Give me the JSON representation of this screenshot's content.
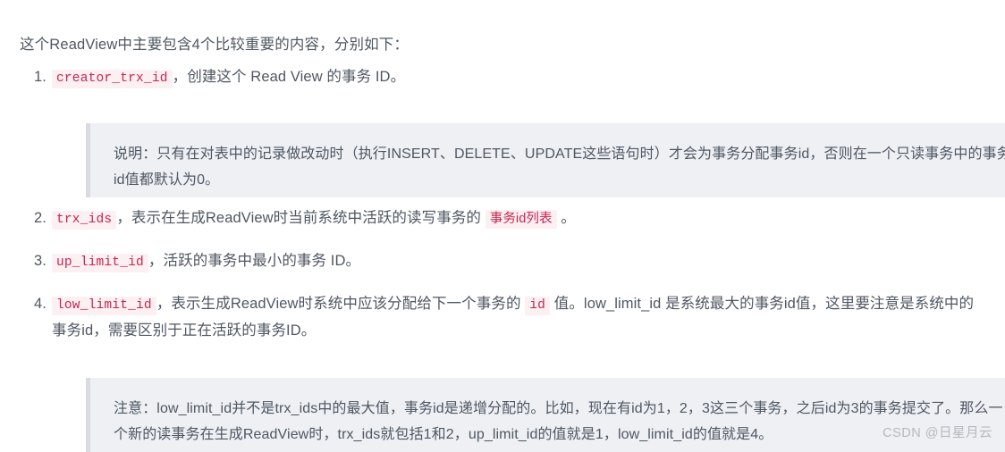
{
  "intro": "这个ReadView中主要包含4个比较重要的内容，分别如下：",
  "list": [
    {
      "marker": "1.",
      "code": "creator_trx_id",
      "text_after": "，创建这个 Read View 的事务 ID。"
    },
    {
      "marker": "2.",
      "code": "trx_ids",
      "text_mid": "，表示在生成ReadView时当前系统中活跃的读写事务的 ",
      "code2": "事务id列表",
      "text_after": " 。"
    },
    {
      "marker": "3.",
      "code": "up_limit_id",
      "text_after": "，活跃的事务中最小的事务 ID。"
    },
    {
      "marker": "4.",
      "code": "low_limit_id",
      "text_mid": "，表示生成ReadView时系统中应该分配给下一个事务的 ",
      "code2": "id",
      "text_after": " 值。low_limit_id 是系统最大的事务id值，这里要注意是系统中的事务id，需要区别于正在活跃的事务ID。"
    }
  ],
  "notes": [
    {
      "id": "note-1",
      "text": "说明：只有在对表中的记录做改动时（执行INSERT、DELETE、UPDATE这些语句时）才会为事务分配事务id，否则在一个只读事务中的事务id值都默认为0。"
    },
    {
      "id": "note-2",
      "text": "注意：low_limit_id并不是trx_ids中的最大值，事务id是递增分配的。比如，现在有id为1，2，3这三个事务，之后id为3的事务提交了。那么一个新的读事务在生成ReadView时，trx_ids就包括1和2，up_limit_id的值就是1，low_limit_id的值就是4。"
    }
  ],
  "watermark": "CSDN @日星月云",
  "colors": {
    "text": "#4f5762",
    "code_text": "#c7254e",
    "code_bg": "#fdf0f3",
    "note_bg": "#eef0f4",
    "note_border": "#d9dbe1",
    "watermark": "#b5b8be",
    "page_bg": "#ffffff"
  }
}
